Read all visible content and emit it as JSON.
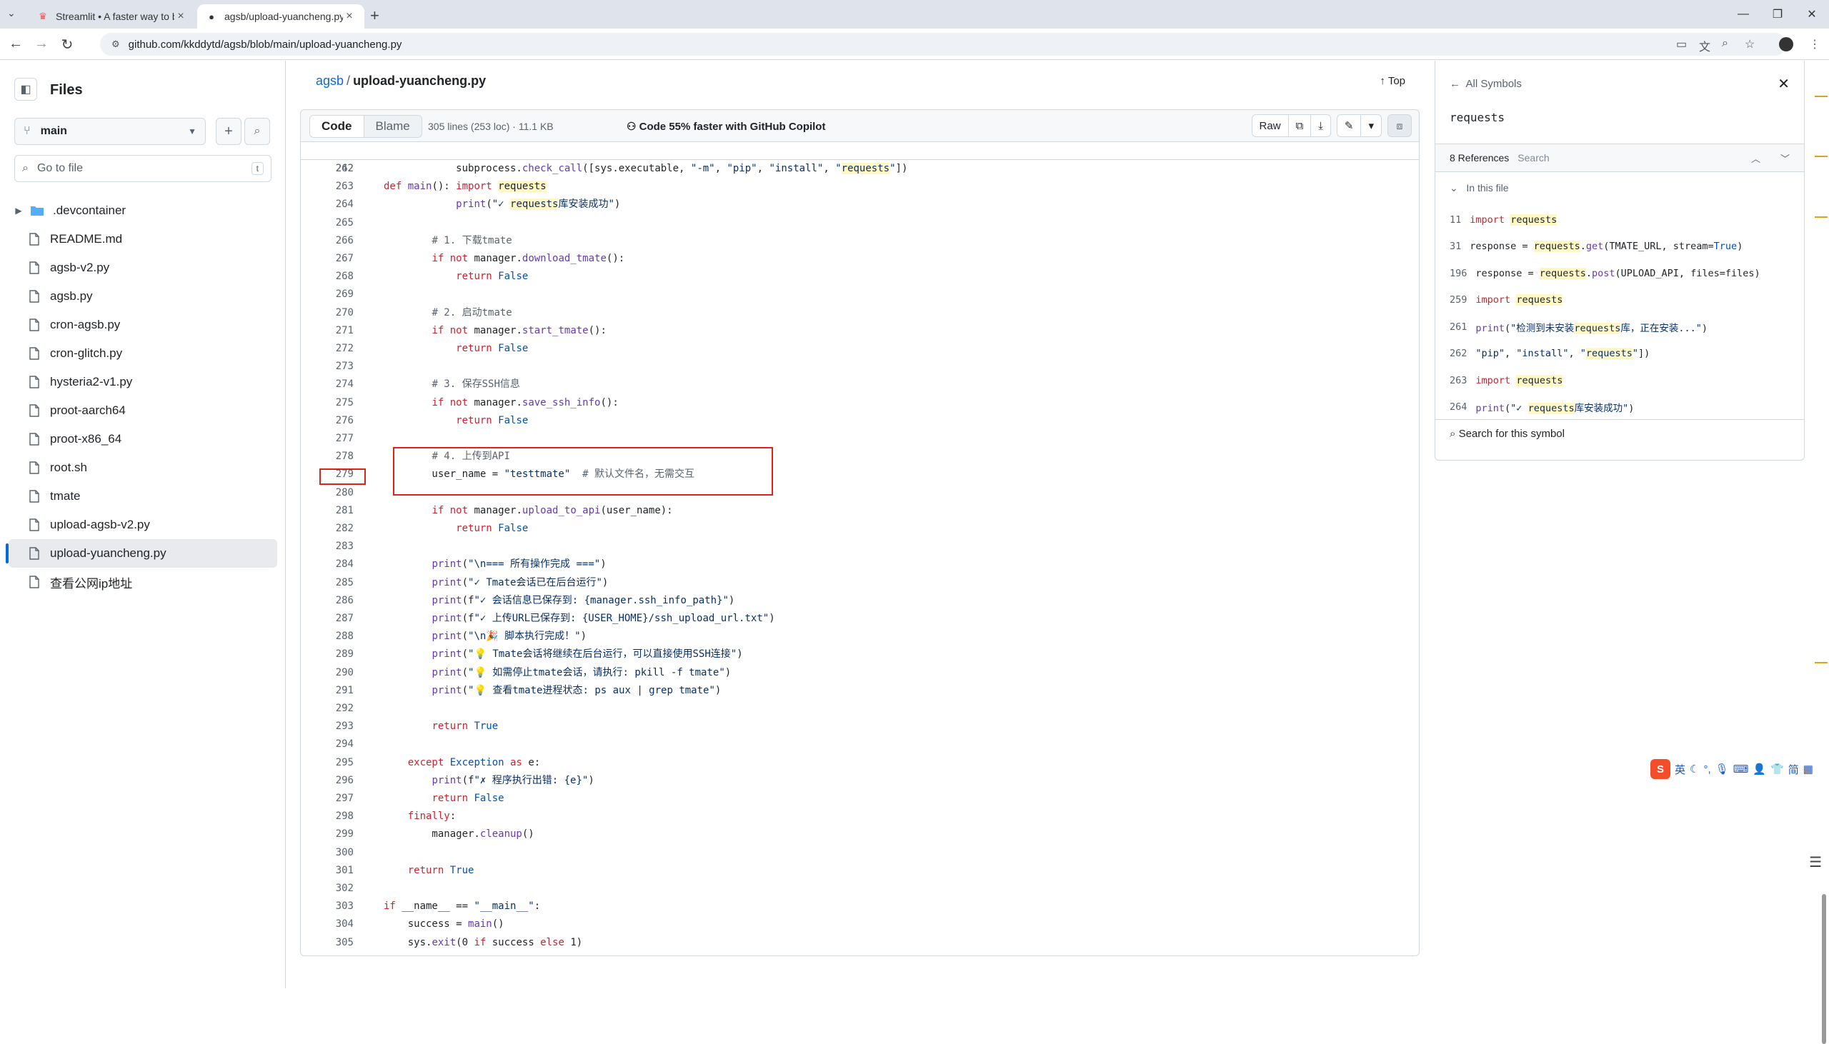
{
  "browser": {
    "tabs": [
      {
        "title": "Streamlit • A faster way to bu",
        "icon": "streamlit-icon",
        "active": false
      },
      {
        "title": "agsb/upload-yuancheng.py a",
        "icon": "github-icon",
        "active": true
      }
    ],
    "url": "github.com/kkddytd/agsb/blob/main/upload-yuancheng.py"
  },
  "sidebar": {
    "title": "Files",
    "branch": "main",
    "goto_placeholder": "Go to file",
    "goto_key": "t",
    "items": [
      {
        "label": ".devcontainer",
        "type": "folder"
      },
      {
        "label": "README.md",
        "type": "file"
      },
      {
        "label": "agsb-v2.py",
        "type": "file"
      },
      {
        "label": "agsb.py",
        "type": "file"
      },
      {
        "label": "cron-agsb.py",
        "type": "file"
      },
      {
        "label": "cron-glitch.py",
        "type": "file"
      },
      {
        "label": "hysteria2-v1.py",
        "type": "file"
      },
      {
        "label": "proot-aarch64",
        "type": "file"
      },
      {
        "label": "proot-x86_64",
        "type": "file"
      },
      {
        "label": "root.sh",
        "type": "file"
      },
      {
        "label": "tmate",
        "type": "file"
      },
      {
        "label": "upload-agsb-v2.py",
        "type": "file"
      },
      {
        "label": "upload-yuancheng.py",
        "type": "file",
        "active": true
      },
      {
        "label": "查看公网ip地址",
        "type": "file"
      }
    ]
  },
  "file": {
    "repo": "agsb",
    "separator": "/",
    "name": "upload-yuancheng.py",
    "top_label": "Top",
    "code_tab": "Code",
    "blame_tab": "Blame",
    "stats": "305 lines (253 loc) · 11.1 KB",
    "copilot": "Code 55% faster with GitHub Copilot",
    "raw_label": "Raw"
  },
  "code": {
    "sticky": {
      "ln": "242",
      "text": "def main():"
    },
    "lines": [
      {
        "ln": "262",
        "text": "            subprocess.check_call([sys.executable, \"-m\", \"pip\", \"install\", \"requests\"])"
      },
      {
        "ln": "263",
        "text": "            import requests"
      },
      {
        "ln": "264",
        "text": "            print(\"✓ requests库安装成功\")"
      },
      {
        "ln": "265",
        "text": ""
      },
      {
        "ln": "266",
        "text": "        # 1. 下载tmate"
      },
      {
        "ln": "267",
        "text": "        if not manager.download_tmate():"
      },
      {
        "ln": "268",
        "text": "            return False"
      },
      {
        "ln": "269",
        "text": ""
      },
      {
        "ln": "270",
        "text": "        # 2. 启动tmate"
      },
      {
        "ln": "271",
        "text": "        if not manager.start_tmate():"
      },
      {
        "ln": "272",
        "text": "            return False"
      },
      {
        "ln": "273",
        "text": ""
      },
      {
        "ln": "274",
        "text": "        # 3. 保存SSH信息"
      },
      {
        "ln": "275",
        "text": "        if not manager.save_ssh_info():"
      },
      {
        "ln": "276",
        "text": "            return False"
      },
      {
        "ln": "277",
        "text": ""
      },
      {
        "ln": "278",
        "text": "        # 4. 上传到API"
      },
      {
        "ln": "279",
        "text": "        user_name = \"testtmate\"  # 默认文件名，无需交互"
      },
      {
        "ln": "280",
        "text": ""
      },
      {
        "ln": "281",
        "text": "        if not manager.upload_to_api(user_name):"
      },
      {
        "ln": "282",
        "text": "            return False"
      },
      {
        "ln": "283",
        "text": ""
      },
      {
        "ln": "284",
        "text": "        print(\"\\n=== 所有操作完成 ===\")"
      },
      {
        "ln": "285",
        "text": "        print(\"✓ Tmate会话已在后台运行\")"
      },
      {
        "ln": "286",
        "text": "        print(f\"✓ 会话信息已保存到: {manager.ssh_info_path}\")"
      },
      {
        "ln": "287",
        "text": "        print(f\"✓ 上传URL已保存到: {USER_HOME}/ssh_upload_url.txt\")"
      },
      {
        "ln": "288",
        "text": "        print(\"\\n🎉 脚本执行完成！\")"
      },
      {
        "ln": "289",
        "text": "        print(\"💡 Tmate会话将继续在后台运行，可以直接使用SSH连接\")"
      },
      {
        "ln": "290",
        "text": "        print(\"💡 如需停止tmate会话，请执行: pkill -f tmate\")"
      },
      {
        "ln": "291",
        "text": "        print(\"💡 查看tmate进程状态: ps aux | grep tmate\")"
      },
      {
        "ln": "292",
        "text": ""
      },
      {
        "ln": "293",
        "text": "        return True"
      },
      {
        "ln": "294",
        "text": ""
      },
      {
        "ln": "295",
        "text": "    except Exception as e:"
      },
      {
        "ln": "296",
        "text": "        print(f\"✗ 程序执行出错: {e}\")"
      },
      {
        "ln": "297",
        "text": "        return False"
      },
      {
        "ln": "298",
        "text": "    finally:"
      },
      {
        "ln": "299",
        "text": "        manager.cleanup()"
      },
      {
        "ln": "300",
        "text": ""
      },
      {
        "ln": "301",
        "text": "    return True"
      },
      {
        "ln": "302",
        "text": ""
      },
      {
        "ln": "303",
        "text": "if __name__ == \"__main__\":"
      },
      {
        "ln": "304",
        "text": "    success = main()"
      },
      {
        "ln": "305",
        "text": "    sys.exit(0 if success else 1)"
      }
    ]
  },
  "symbols": {
    "back_label": "All Symbols",
    "name": "requests",
    "ref_count": "8 References",
    "search_placeholder": "Search",
    "in_this_file": "In this file",
    "refs": [
      {
        "ln": "11",
        "text": "import requests"
      },
      {
        "ln": "31",
        "text": "response = requests.get(TMATE_URL, stream=True)"
      },
      {
        "ln": "196",
        "text": "response = requests.post(UPLOAD_API, files=files)"
      },
      {
        "ln": "259",
        "text": "import requests"
      },
      {
        "ln": "261",
        "text": "print(\"检测到未安装requests库，正在安装...\")"
      },
      {
        "ln": "262",
        "text": "\"pip\", \"install\", \"requests\"])"
      },
      {
        "ln": "263",
        "text": "import requests"
      },
      {
        "ln": "264",
        "text": "print(\"✓ requests库安装成功\")"
      }
    ],
    "search_symbol": "Search for this symbol"
  },
  "ime": {
    "lang": "英",
    "mode": "简"
  },
  "colors": {
    "accent": "#0969da",
    "highlight": "#fff8c5",
    "annotation": "#e0201d"
  }
}
